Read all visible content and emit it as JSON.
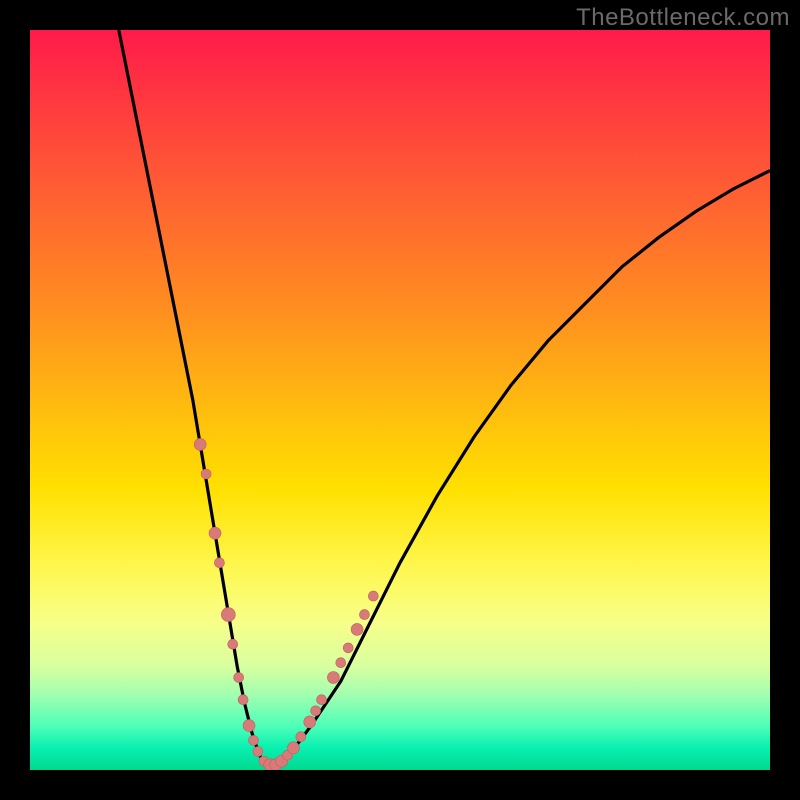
{
  "watermark": "TheBottleneck.com",
  "colors": {
    "frame_background": "#000000",
    "gradient_top": "#ff1a4a",
    "gradient_bottom": "#00d890",
    "curve_stroke": "#000000",
    "dot_fill": "#d87a78",
    "dot_stroke": "#c06060",
    "watermark_text": "#6a6a6a"
  },
  "chart_data": {
    "type": "line",
    "title": "",
    "xlabel": "",
    "ylabel": "",
    "xlim": [
      0,
      100
    ],
    "ylim": [
      0,
      100
    ],
    "grid": false,
    "legend": false,
    "series": [
      {
        "name": "curve",
        "x": [
          12,
          14,
          16,
          18,
          20,
          22,
          23,
          24,
          25,
          26,
          27,
          28,
          29,
          30,
          31,
          32,
          33,
          35,
          38,
          42,
          46,
          50,
          55,
          60,
          65,
          70,
          75,
          80,
          85,
          90,
          95,
          100
        ],
        "y": [
          100,
          90,
          80,
          70,
          60,
          50,
          44,
          38,
          32,
          26,
          20,
          14,
          9,
          5,
          2,
          0.6,
          0.6,
          2,
          6,
          12,
          20,
          28,
          37,
          45,
          52,
          58,
          63,
          68,
          72,
          75.5,
          78.5,
          81
        ]
      }
    ],
    "data_points": [
      {
        "x": 23.0,
        "y": 44
      },
      {
        "x": 23.8,
        "y": 40
      },
      {
        "x": 25.0,
        "y": 32
      },
      {
        "x": 25.6,
        "y": 28
      },
      {
        "x": 26.8,
        "y": 21
      },
      {
        "x": 27.4,
        "y": 17
      },
      {
        "x": 28.2,
        "y": 12.5
      },
      {
        "x": 28.8,
        "y": 9.5
      },
      {
        "x": 29.6,
        "y": 6
      },
      {
        "x": 30.2,
        "y": 4
      },
      {
        "x": 30.8,
        "y": 2.5
      },
      {
        "x": 31.6,
        "y": 1.2
      },
      {
        "x": 32.4,
        "y": 0.7
      },
      {
        "x": 33.2,
        "y": 0.7
      },
      {
        "x": 34.0,
        "y": 1.2
      },
      {
        "x": 34.8,
        "y": 2
      },
      {
        "x": 35.6,
        "y": 3
      },
      {
        "x": 36.6,
        "y": 4.5
      },
      {
        "x": 37.8,
        "y": 6.5
      },
      {
        "x": 38.6,
        "y": 8
      },
      {
        "x": 39.4,
        "y": 9.5
      },
      {
        "x": 41.0,
        "y": 12.5
      },
      {
        "x": 42.0,
        "y": 14.5
      },
      {
        "x": 43.0,
        "y": 16.5
      },
      {
        "x": 44.2,
        "y": 19
      },
      {
        "x": 45.2,
        "y": 21
      },
      {
        "x": 46.4,
        "y": 23.5
      }
    ],
    "data_point_radii": [
      6,
      5,
      6,
      5,
      7,
      5,
      5,
      5,
      6,
      5,
      5,
      5,
      6,
      6,
      6,
      5,
      6,
      5,
      6,
      5,
      5,
      6,
      5,
      5,
      6,
      5,
      5
    ]
  }
}
